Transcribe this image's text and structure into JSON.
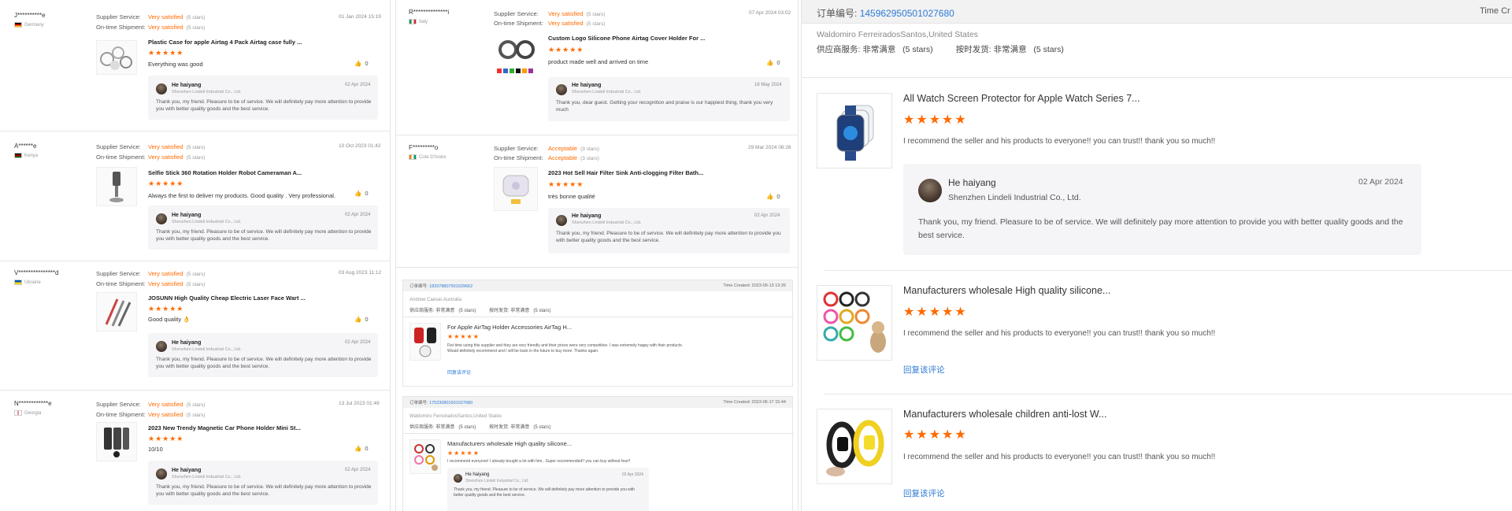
{
  "labels": {
    "supplier_service": "Supplier Service:",
    "ontime_shipment": "On-time Shipment:",
    "reply_name": "He haiyang",
    "reply_company": "Shenzhen Lindeli Industrial Co., Ltd.",
    "reply_text": "Thank you, my friend. Pleasure to be of service. We will definitely pay more attention to provide you with better quality goods and the best service.",
    "stars_glyph": "★★★★★"
  },
  "panel1": {
    "reviews": [
      {
        "name": "J**********e",
        "country": "Germany",
        "flag": [
          "#000000",
          "#dd0000",
          "#ffce00"
        ],
        "service": "Very satisfied",
        "service_stars": "(5 stars)",
        "shipment": "Very satisfied",
        "shipment_stars": "(5 stars)",
        "date": "01 Jan 2024 15:19",
        "product": "Plastic Case for apple Airtag 4 Pack Airtag case fully ...",
        "comment": "Everything was good",
        "likes": "0",
        "reply_date": "02 Apr 2024"
      },
      {
        "name": "A******e",
        "country": "Kenya",
        "flag": [
          "#000000",
          "#bb0000",
          "#006600"
        ],
        "service": "Very satisfied",
        "service_stars": "(5 stars)",
        "shipment": "Very satisfied",
        "shipment_stars": "(5 stars)",
        "date": "10 Oct 2023 01:42",
        "product": "Selfie Stick 360 Rotation Holder Robot Cameraman A...",
        "comment": "Always the first to deliver my products. Good quality . Very professional.",
        "likes": "0",
        "reply_date": "02 Apr 2024"
      },
      {
        "name": "V***************d",
        "country": "Ukraine",
        "flag": [
          "#0057b7",
          "#ffd700",
          "#ffd700"
        ],
        "service": "Very satisfied",
        "service_stars": "(5 stars)",
        "shipment": "Very satisfied",
        "shipment_stars": "(5 stars)",
        "date": "03 Aug 2023 11:12",
        "product": "JOSUNN High Quality Cheap Electric Laser Face Wart ...",
        "comment": "Good quality 👌",
        "likes": "0",
        "reply_date": "02 Apr 2024"
      },
      {
        "name": "N************e",
        "country": "Georgia",
        "flag": [
          "#ffffff",
          "#e8112d",
          "#ffffff"
        ],
        "service": "Very satisfied",
        "service_stars": "(5 stars)",
        "shipment": "Very satisfied",
        "shipment_stars": "(5 stars)",
        "date": "13 Jul 2023 01:49",
        "product": "2023 New Trendy Magnetic Car Phone Holder Mini St...",
        "comment": "10/10",
        "likes": "0",
        "reply_date": "02 Apr 2024"
      }
    ]
  },
  "panel2": {
    "reviews": [
      {
        "name": "R**************i",
        "country": "Italy",
        "flag": [
          "#009246",
          "#ffffff",
          "#ce2b37"
        ],
        "service": "Very satisfied",
        "service_stars": "(5 stars)",
        "shipment": "Very satisfied",
        "shipment_stars": "(5 stars)",
        "date": "07 Apr 2024 03:02",
        "product": "Custom Logo Silicone Phone Airtag Cover Holder For ...",
        "comment": "product made well and arrived on time",
        "likes": "0",
        "reply_date": "16 May 2024",
        "reply_text": "Thank you, dear guest. Getting your recognition and praise is our happiest thing, thank you very much"
      },
      {
        "name": "F*********o",
        "country": "Cote D'Ivoire",
        "flag": [
          "#f77f00",
          "#ffffff",
          "#009e60"
        ],
        "service": "Acceptable",
        "service_stars": "(3 stars)",
        "shipment": "Acceptable",
        "shipment_stars": "(3 stars)",
        "date": "29 Mar 2024 08:26",
        "product": "2023 Hot Sell Hair Filter Sink Anti-clogging Filter Bath...",
        "comment": "très bonne qualité",
        "likes": "0",
        "reply_date": "02 Apr 2024"
      }
    ],
    "orders": [
      {
        "label": "订单编号:",
        "number": "183378807501029662",
        "time": "Time Created: 2023-09-13 13:26",
        "buyer": "Andrew Caesar,Australia",
        "ratings": "供应商服务: 非常满意   (5 stars)          按时发货: 非常满意   (5 stars)",
        "product": "For Apple AirTag Holder Accessories AirTag H...",
        "comment": "Fist time using this supplier and they are very friendly and their prices were very competitive. I was extremely happy with their products. Would definitely recommend and I will be back in the future to buy more. Thanks again.",
        "reply_link": "回复该评论"
      },
      {
        "label": "订单编号:",
        "number": "175230801501027680",
        "time": "Time Created: 2023-06-17 15:44",
        "buyer": "Waldomiro FerreiradosSantos,United States",
        "ratings": "供应商服务: 非常满意   (5 stars)          按时发货: 非常满意   (5 stars)",
        "product": "Manufacturers wholesale High quality silicone...",
        "comment": "I recommend everyone! I already bought a lot with him.. Super recommended!! you can buy without fear!!",
        "reply_date": "02 Apr 2024",
        "reply_text": "Thank you, my friend. Pleasure to be of service. We will definitely pay more attention to provide you with better quality goods and the best service."
      }
    ]
  },
  "panel3": {
    "order_label": "订单编号:",
    "order_number": "145962950501027680",
    "time_created": "Time Cr",
    "buyer": "Waldomiro FerreiradosSantos,United States",
    "ratings": "供应商服务: 非常满意   (5 stars)          按时发货: 非常满意   (5 stars)",
    "items": [
      {
        "title": "All Watch Screen Protector for Apple Watch Series 7...",
        "comment": "I recommend the seller and his products to everyone!!  you can trust!!  thank you so much!!",
        "reply_date": "02 Apr 2024"
      },
      {
        "title": "Manufacturers wholesale High quality silicone...",
        "comment": "I recommend the seller and his products to everyone!!  you can trust!!  thank you so much!!",
        "reply_link": "回复该评论"
      },
      {
        "title": "Manufacturers wholesale children anti-lost W...",
        "comment": "I recommend the seller and his products to everyone!!  you can trust!!  thank you so much!!",
        "reply_link": "回复该评论"
      }
    ]
  },
  "colors": {
    "accent": "#ff6a00",
    "link": "#2d7ad6",
    "reply_bg": "#f5f5f7"
  }
}
